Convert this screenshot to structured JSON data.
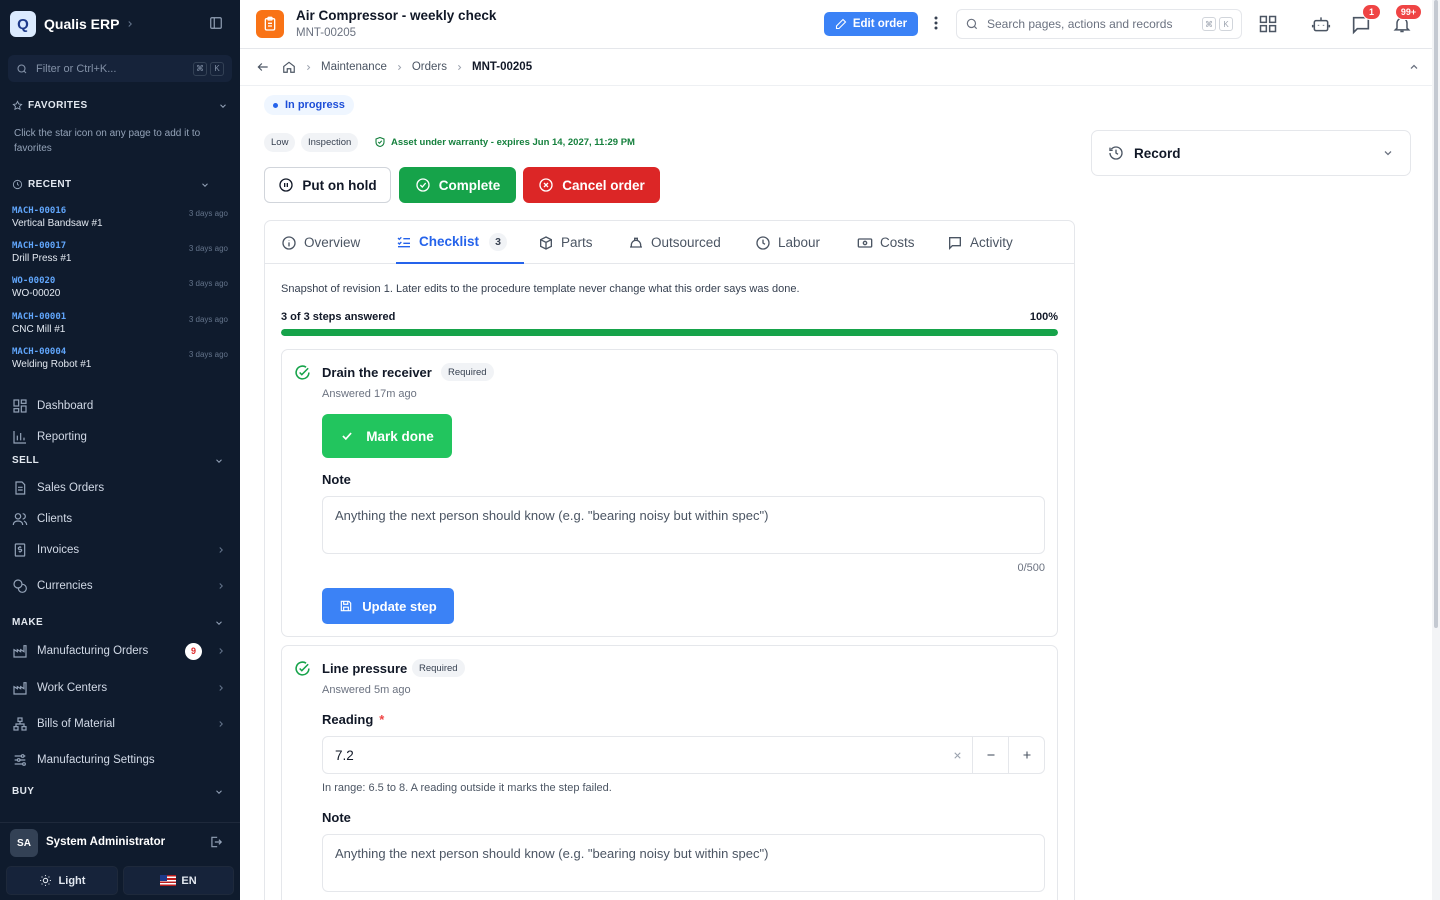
{
  "sidebar": {
    "brand": "Qualis ERP",
    "brand_logo": "Q",
    "filter_placeholder": "Filter or Ctrl+K...",
    "filter_keys": [
      "⌘",
      "K"
    ],
    "favorites": {
      "title": "FAVORITES",
      "note": "Click the star icon on any page to add it to favorites"
    },
    "recent": {
      "title": "RECENT",
      "items": [
        {
          "code": "MACH-00016",
          "name": "Vertical Bandsaw #1",
          "time": "3 days ago"
        },
        {
          "code": "MACH-00017",
          "name": "Drill Press #1",
          "time": "3 days ago"
        },
        {
          "code": "WO-00020",
          "name": "WO-00020",
          "time": "3 days ago"
        },
        {
          "code": "MACH-00001",
          "name": "CNC Mill #1",
          "time": "3 days ago"
        },
        {
          "code": "MACH-00004",
          "name": "Welding Robot #1",
          "time": "3 days ago"
        }
      ]
    },
    "nav": {
      "dashboard": "Dashboard",
      "reporting": "Reporting",
      "sell_title": "SELL",
      "sales_orders": "Sales Orders",
      "clients": "Clients",
      "invoices": "Invoices",
      "currencies": "Currencies",
      "make_title": "MAKE",
      "manufacturing_orders": "Manufacturing Orders",
      "manufacturing_orders_badge": "9",
      "work_centers": "Work Centers",
      "bills_of_material": "Bills of Material",
      "manufacturing_settings": "Manufacturing Settings",
      "buy_title": "BUY"
    },
    "user": {
      "initials": "SA",
      "name": "System Administrator"
    },
    "theme_label": "Light",
    "lang_label": "EN"
  },
  "header": {
    "title": "Air Compressor - weekly check",
    "subtitle": "MNT-00205",
    "edit_label": "Edit order",
    "search_placeholder": "Search pages, actions and records",
    "search_keys": [
      "⌘",
      "K"
    ],
    "messages_badge": "1",
    "notifications_badge": "99+"
  },
  "breadcrumb": {
    "items": [
      "Maintenance",
      "Orders"
    ],
    "current": "MNT-00205"
  },
  "order": {
    "status": "In progress",
    "tags": [
      "Low",
      "Inspection"
    ],
    "warranty": "Asset under warranty - expires Jun 14, 2027, 11:29 PM",
    "actions": {
      "hold": "Put on hold",
      "complete": "Complete",
      "cancel": "Cancel order"
    }
  },
  "record_panel": {
    "label": "Record"
  },
  "tabs": [
    {
      "label": "Overview"
    },
    {
      "label": "Checklist",
      "count": "3"
    },
    {
      "label": "Parts"
    },
    {
      "label": "Outsourced"
    },
    {
      "label": "Labour"
    },
    {
      "label": "Costs"
    },
    {
      "label": "Activity"
    }
  ],
  "checklist": {
    "snapshot_note": "Snapshot of revision 1. Later edits to the procedure template never change what this order says was done.",
    "progress_label": "3 of 3 steps answered",
    "progress_pct_label": "100%",
    "progress": 1.0,
    "steps": [
      {
        "title": "Drain the receiver",
        "required_label": "Required",
        "answered": "Answered 17m ago",
        "mark_done_label": "Mark done",
        "note_label": "Note",
        "note_placeholder": "Anything the next person should know (e.g. \"bearing noisy but within spec\")",
        "note_counter": "0/500",
        "update_label": "Update step"
      },
      {
        "title": "Line pressure",
        "required_label": "Required",
        "answered": "Answered 5m ago",
        "reading_label": "Reading",
        "required_star": "*",
        "reading_value": "7.2",
        "range_note": "In range: 6.5 to 8. A reading outside it marks the step failed.",
        "note_label": "Note",
        "note_placeholder": "Anything the next person should know (e.g. \"bearing noisy but within spec\")"
      }
    ]
  },
  "colors": {
    "primary": "#3b82f6",
    "success": "#22c55e",
    "danger": "#dc2626",
    "sidebar": "#0f1b2d",
    "accent_orange": "#f97316"
  }
}
